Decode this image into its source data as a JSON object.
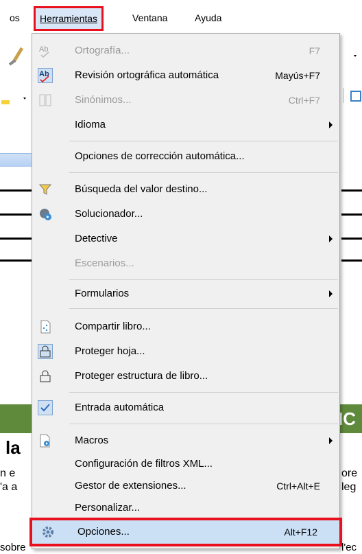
{
  "menubar": {
    "partial_left": "os",
    "herramientas": "Herramientas",
    "ventana": "Ventana",
    "ayuda": "Ayuda"
  },
  "background": {
    "green_heading_fragment": "IC",
    "heading_fragment": "la",
    "text_lines_left": [
      "n e",
      "'a a"
    ],
    "text_lines_right": [
      "ore",
      "leg"
    ],
    "bottom_left": "sobre",
    "bottom_right": "l'ec"
  },
  "menu": {
    "items": [
      {
        "label": "Ortografía...",
        "shortcut": "F7",
        "icon": "spellcheck-icon"
      },
      {
        "label": "Revisión ortográfica automática",
        "shortcut": "Mayús+F7",
        "icon": "auto-spellcheck-icon"
      },
      {
        "label": "Sinónimos...",
        "shortcut": "Ctrl+F7",
        "icon": "thesaurus-icon"
      },
      {
        "label": "Idioma",
        "shortcut": ""
      },
      {
        "label": "Opciones de corrección automática...",
        "shortcut": ""
      },
      {
        "label": "Búsqueda del valor destino...",
        "shortcut": "",
        "icon": "goal-seek-icon"
      },
      {
        "label": "Solucionador...",
        "shortcut": "",
        "icon": "solver-icon"
      },
      {
        "label": "Detective",
        "shortcut": ""
      },
      {
        "label": "Escenarios...",
        "shortcut": ""
      },
      {
        "label": "Formularios",
        "shortcut": ""
      },
      {
        "label": "Compartir libro...",
        "shortcut": "",
        "icon": "share-document-icon"
      },
      {
        "label": "Proteger hoja...",
        "shortcut": "",
        "icon": "lock-icon"
      },
      {
        "label": "Proteger estructura de libro...",
        "shortcut": "",
        "icon": "lock-icon"
      },
      {
        "label": "Entrada automática",
        "shortcut": "",
        "icon": "checkmark-icon"
      },
      {
        "label": "Macros",
        "shortcut": "",
        "icon": "macros-icon"
      },
      {
        "label": "Configuración de filtros XML...",
        "shortcut": ""
      },
      {
        "label": "Gestor de extensiones...",
        "shortcut": "Ctrl+Alt+E"
      },
      {
        "label": "Personalizar...",
        "shortcut": ""
      },
      {
        "label": "Opciones...",
        "shortcut": "Alt+F12",
        "icon": "gear-icon"
      }
    ]
  },
  "colors": {
    "highlight_border": "#e8101c",
    "selected_bg": "#cce0f5",
    "menu_bg": "#f0f0f0",
    "green_bar": "#5f8a3c"
  }
}
